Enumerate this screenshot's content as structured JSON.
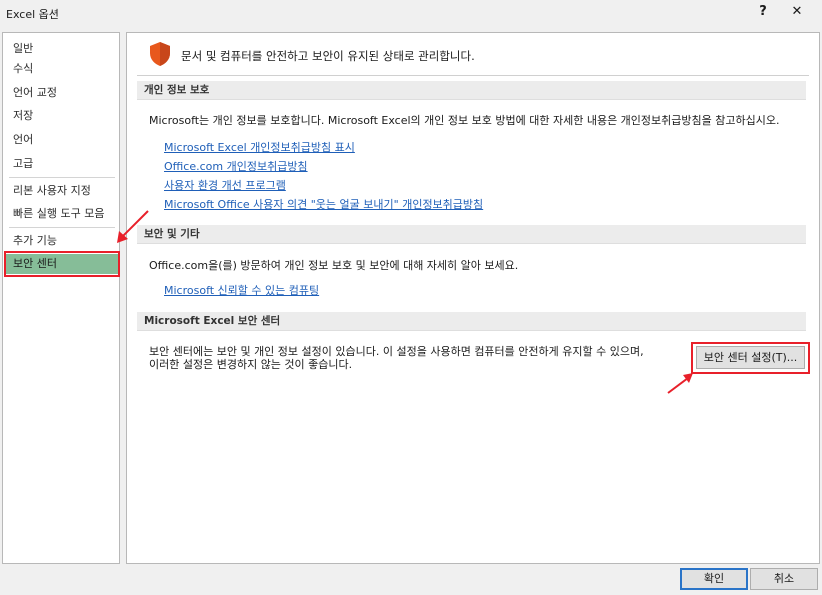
{
  "window": {
    "title": "Excel 옵션",
    "help": "?",
    "close": "✕"
  },
  "nav": {
    "items": [
      {
        "label": "일반"
      },
      {
        "label": "수식"
      },
      {
        "label": "언어 교정"
      },
      {
        "label": "저장"
      },
      {
        "label": "언어"
      },
      {
        "label": "고급"
      },
      {
        "label": "리본 사용자 지정"
      },
      {
        "label": "빠른 실행 도구 모음"
      },
      {
        "label": "추가 기능"
      },
      {
        "label": "보안 센터"
      }
    ],
    "selected": "보안 센터"
  },
  "header": {
    "icon": "shield-icon",
    "text": "문서 및 컴퓨터를 안전하고 보안이 유지된 상태로 관리합니다."
  },
  "privacy": {
    "title": "개인 정보 보호",
    "description": "Microsoft는 개인 정보를 보호합니다. Microsoft Excel의 개인 정보 보호 방법에 대한 자세한 내용은 개인정보취급방침을 참고하십시오.",
    "links": [
      "Microsoft Excel 개인정보취급방침 표시",
      "Office.com 개인정보취급방침",
      "사용자 환경 개선 프로그램",
      "Microsoft Office 사용자 의견 \"웃는 얼굴 보내기\" 개인정보취급방침"
    ]
  },
  "security": {
    "title": "보안 및 기타",
    "description": "Office.com을(를) 방문하여 개인 정보 보호 및 보안에 대해 자세히 알아 보세요.",
    "link": "Microsoft 신뢰할 수 있는 컴퓨팅"
  },
  "trust_center": {
    "title": "Microsoft Excel 보안 센터",
    "line1": "보안 센터에는 보안 및 개인 정보 설정이 있습니다. 이 설정을 사용하면 컴퓨터를 안전하게 유지할 수 있으며,",
    "line2": "이러한 설정은 변경하지 않는 것이 좋습니다.",
    "button": "보안 센터 설정(T)..."
  },
  "footer": {
    "ok": "확인",
    "cancel": "취소"
  },
  "colors": {
    "selected_nav": "#86bd98",
    "highlight": "#e8202a",
    "link": "#1f5fb8",
    "shield": "#e8581c"
  }
}
